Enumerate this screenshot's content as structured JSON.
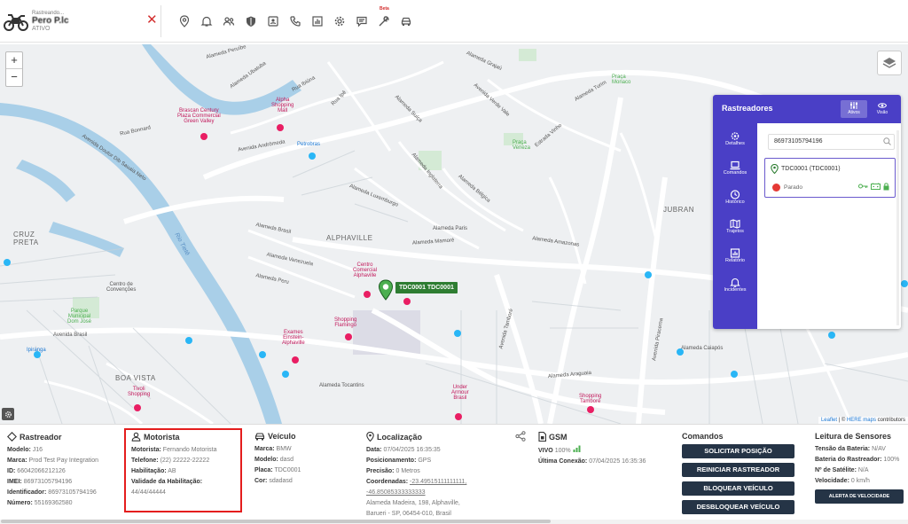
{
  "topbar": {
    "subtitle": "Rastreando...",
    "tracker_name": "Pero P.lc",
    "status": "ATIVO",
    "beta_label": "Beta",
    "icons": [
      "map-pin-icon",
      "bell-icon",
      "users-icon",
      "shield-icon",
      "id-card-icon",
      "phone-icon",
      "chart-icon",
      "gear-icon",
      "message-icon",
      "wrench-icon",
      "car-icon"
    ]
  },
  "map": {
    "zoom_in": "+",
    "zoom_out": "−",
    "vehicle_label": "TDC0001 TDC0001",
    "attribution_leaflet": "Leaflet",
    "attribution_sep": " | © ",
    "attribution_here": "HERE maps",
    "attribution_rest": " contributors",
    "labels": {
      "alphaville": "ALPHAVILLE",
      "jubran": "JUBRAN",
      "cruz_preta": "CRUZ\nPRETA",
      "boa_vista": "BOA VISTA",
      "rio_tiete": "Rio Tietê",
      "av_peruibe": "Alameda Peruíbe",
      "av_andromeda": "Avenida Andrômeda",
      "al_brasil": "Alameda Brasil",
      "al_venezuela": "Alameda Venezuela",
      "al_peru": "Alameda Peru",
      "al_mamore": "Alameda Mamoré",
      "al_araguaia": "Alameda Araguaia",
      "al_tocantins": "Alameda Tocantins",
      "av_amazonas": "Alameda Amazonas",
      "al_luxemburgo": "Alameda Luxemburgo",
      "al_paris": "Alameda Paris",
      "al_inglaterra": "Alameda Inglaterra",
      "al_belgica": "Alameda Bélgica",
      "av_verde_vale": "Avenida Verde Vale",
      "al_suica": "Alameda Suíça",
      "estrada_vinho": "Estrada Vinho",
      "rua_bonnard": "Rua Bonnard",
      "av_sao_paulo": "Avenida Doutor Dib Sauaia Neto",
      "rua_ipe": "Rua Ipê",
      "rua_ibiuna": "Rua Ibiúna",
      "al_turim": "Alameda Turim",
      "praca_veneza": "Praça\nVeneza",
      "praca_monaco": "Praça\nMonaco",
      "al_grajau": "Alameda Grajaú",
      "av_tambore": "Avenida Tamboré",
      "av_piracema": "Avenida Piracema",
      "al_caiapos": "Alameda Caiapós",
      "av_brasil": "Avenida Brasil",
      "al_ubatuba": "Alameda Ubatuba",
      "centro_convencoes": "Centro de\nConvenções",
      "parque_dom_jose": "Parque\nMunicipal\nDom José"
    },
    "pois": {
      "braskan": "Brascan Century\nPlaza Commercial\nGreen Valley",
      "alpha_shopping": "Alpha\nShopping\nMall",
      "petrobras": "Petrobras",
      "centro_comercial": "Centro\nComercial\nAlphaville",
      "shopping_flamingo": "Shopping\nFlamingo",
      "exames": "Exames\nEinstein-\nAlphaville",
      "under_armour": "Under\nArmour\nBrasil",
      "shopping_tambore": "Shopping\nTamboré",
      "tivoli": "Tivoli\nShopping",
      "ipiranga": "Ipiranga"
    }
  },
  "panel": {
    "title": "Rastreadores",
    "tab_active": "Ativos",
    "tab_view": "Visão",
    "side": [
      "Detalhes",
      "Comandos",
      "Histórico",
      "Trajetos",
      "Relatório",
      "Incidentes"
    ],
    "search_value": "86973105794196",
    "card_title": "TDC0001 (TDC0001)",
    "card_status": "Parado"
  },
  "info": {
    "rastreador": {
      "title": "Rastreador",
      "rows": [
        {
          "k": "Modelo:",
          "v": "J16"
        },
        {
          "k": "Marca:",
          "v": "Prod Test Pay Integration"
        },
        {
          "k": "ID:",
          "v": "66042066212126"
        },
        {
          "k": "IMEI:",
          "v": "86973105794196"
        },
        {
          "k": "Identificador:",
          "v": "86973105794196"
        },
        {
          "k": "Número:",
          "v": "55169362580"
        }
      ]
    },
    "motorista": {
      "title": "Motorista",
      "rows": [
        {
          "k": "Motorista:",
          "v": "Fernando Motorista"
        },
        {
          "k": "Telefone:",
          "v": "(22) 22222-22222"
        },
        {
          "k": "Habilitação:",
          "v": "AB"
        },
        {
          "k": "Validade da Habilitação:",
          "v": ""
        }
      ],
      "validade_value": "44/44/44444"
    },
    "veiculo": {
      "title": "Veículo",
      "rows": [
        {
          "k": "Marca:",
          "v": "BMW"
        },
        {
          "k": "Modelo:",
          "v": "dasd"
        },
        {
          "k": "Placa:",
          "v": "TDC0001"
        },
        {
          "k": "Cor:",
          "v": "sdadasd"
        }
      ]
    },
    "localizacao": {
      "title": "Localização",
      "rows": [
        {
          "k": "Data:",
          "v": "07/04/2025 16:35:35"
        },
        {
          "k": "Posicionamento:",
          "v": "GPS"
        },
        {
          "k": "Precisão:",
          "v": "0 Metros"
        },
        {
          "k": "Coordenadas:",
          "v": "-23.49515111111111,"
        }
      ],
      "coord2": "-46.85085333333333",
      "address1": "Alameda Madeira, 198, Alphaville,",
      "address2": "Barueri - SP, 06454-010, Brasil"
    },
    "gsm": {
      "title": "GSM",
      "rows": [
        {
          "k": "VIVO",
          "v": "100%"
        },
        {
          "k": "Última Conexão:",
          "v": "07/04/2025 16:35:36"
        }
      ]
    },
    "comandos": {
      "title": "Comandos",
      "buttons": [
        "SOLICITAR POSIÇÃO",
        "REINICIAR RASTREADOR",
        "BLOQUEAR VEÍCULO",
        "DESBLOQUEAR VEÍCULO"
      ]
    },
    "sensores": {
      "title": "Leitura de Sensores",
      "rows": [
        {
          "k": "Tensão da Bateria:",
          "v": "N/AV"
        },
        {
          "k": "Bateria do Rastreador:",
          "v": "100%"
        },
        {
          "k": "Nº de Satélite:",
          "v": "N/A"
        },
        {
          "k": "Velocidade:",
          "v": "0 km/h"
        }
      ],
      "alert_button": "ALERTA DE VELOCIDADE"
    }
  },
  "colors": {
    "panel": "#4a3fc6",
    "button": "#253446",
    "highlight": "#e41d1d",
    "vehicle": "#2e7d32"
  }
}
